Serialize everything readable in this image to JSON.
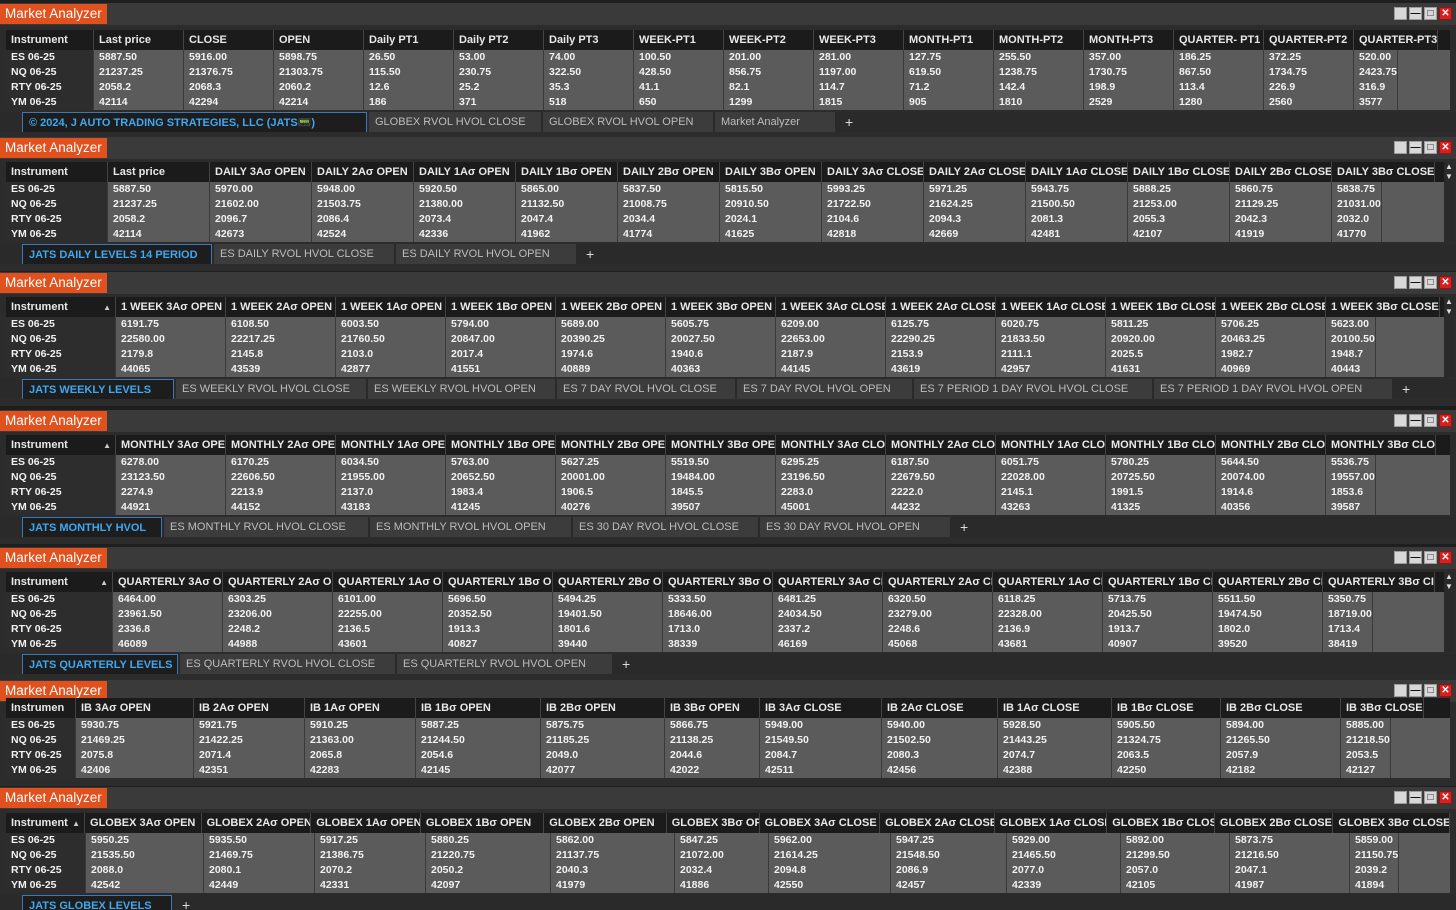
{
  "colors": {
    "title_bg": "#e0511d",
    "active_tab": "#3fa8f0",
    "close_btn": "#d32020"
  },
  "instruments": [
    "ES 06-25",
    "NQ 06-25",
    "RTY 06-25",
    "YM 06-25"
  ],
  "panels": [
    {
      "title": "Market Analyzer",
      "columns": [
        "Instrument",
        "Last price",
        "CLOSE",
        "OPEN",
        "Daily PT1",
        "Daily PT2",
        "Daily PT3",
        "WEEK-PT1",
        "WEEK-PT2",
        "WEEK-PT3",
        "MONTH-PT1",
        "MONTH-PT2",
        "MONTH-PT3",
        "QUARTER- PT1",
        "QUARTER-PT2",
        "QUARTER-PT3"
      ],
      "rows": [
        [
          "5887.50",
          "5916.00",
          "5898.75",
          "26.50",
          "53.00",
          "74.00",
          "100.50",
          "201.00",
          "281.00",
          "127.75",
          "255.50",
          "357.00",
          "186.25",
          "372.25",
          "520.00"
        ],
        [
          "21237.25",
          "21376.75",
          "21303.75",
          "115.50",
          "230.75",
          "322.50",
          "428.50",
          "856.75",
          "1197.00",
          "619.50",
          "1238.75",
          "1730.75",
          "867.50",
          "1734.75",
          "2423.75"
        ],
        [
          "2058.2",
          "2068.3",
          "2060.2",
          "12.6",
          "25.2",
          "35.3",
          "41.1",
          "82.1",
          "114.7",
          "71.2",
          "142.4",
          "198.9",
          "113.4",
          "226.9",
          "316.9"
        ],
        [
          "42114",
          "42294",
          "42214",
          "186",
          "371",
          "518",
          "650",
          "1299",
          "1815",
          "905",
          "1810",
          "2529",
          "1280",
          "2560",
          "3577"
        ]
      ],
      "tabs": [
        "© 2024, J AUTO TRADING STRATEGIES, LLC (JATS📟)",
        "GLOBEX RVOL HVOL CLOSE",
        "GLOBEX RVOL HVOL OPEN",
        "Market Analyzer",
        "+"
      ]
    },
    {
      "title": "Market Analyzer",
      "columns": [
        "Instrument",
        "Last price",
        "DAILY 3Aσ OPEN",
        "DAILY 2Aσ OPEN",
        "DAILY 1Aσ OPEN",
        "DAILY 1Bσ OPEN",
        "DAILY 2Bσ OPEN",
        "DAILY 3Bσ OPEN",
        "DAILY 3Aσ CLOSE",
        "DAILY 2Aσ CLOSE",
        "DAILY 1Aσ CLOSE",
        "DAILY 1Bσ CLOSE",
        "DAILY 2Bσ CLOSE",
        "DAILY 3Bσ CLOSE"
      ],
      "rows": [
        [
          "5887.50",
          "5970.00",
          "5948.00",
          "5920.50",
          "5865.00",
          "5837.50",
          "5815.50",
          "5993.25",
          "5971.25",
          "5943.75",
          "5888.25",
          "5860.75",
          "5838.75"
        ],
        [
          "21237.25",
          "21602.00",
          "21503.75",
          "21380.00",
          "21132.50",
          "21008.75",
          "20910.50",
          "21722.50",
          "21624.25",
          "21500.50",
          "21253.00",
          "21129.25",
          "21031.00"
        ],
        [
          "2058.2",
          "2096.7",
          "2086.4",
          "2073.4",
          "2047.4",
          "2034.4",
          "2024.1",
          "2104.6",
          "2094.3",
          "2081.3",
          "2055.3",
          "2042.3",
          "2032.0"
        ],
        [
          "42114",
          "42673",
          "42524",
          "42336",
          "41962",
          "41774",
          "41625",
          "42818",
          "42669",
          "42481",
          "42107",
          "41919",
          "41770"
        ]
      ],
      "tabs": [
        "JATS DAILY LEVELS 14 PERIOD",
        "ES DAILY RVOL HVOL CLOSE",
        "ES DAILY RVOL HVOL OPEN",
        "+"
      ]
    },
    {
      "title": "Market Analyzer",
      "columns": [
        "Instrument",
        "1 WEEK 3Aσ OPEN",
        "1 WEEK 2Aσ OPEN",
        "1 WEEK 1Aσ OPEN",
        "1 WEEK 1Bσ OPEN",
        "1 WEEK 2Bσ OPEN",
        "1 WEEK 3Bσ OPEN",
        "1 WEEK 3Aσ CLOSE",
        "1 WEEK 2Aσ CLOSE",
        "1 WEEK 1Aσ CLOSE",
        "1 WEEK 1Bσ CLOSE",
        "1 WEEK 2Bσ CLOSE",
        "1 WEEK 3Bσ CLOSE"
      ],
      "rows": [
        [
          "6191.75",
          "6108.50",
          "6003.50",
          "5794.00",
          "5689.00",
          "5605.75",
          "6209.00",
          "6125.75",
          "6020.75",
          "5811.25",
          "5706.25",
          "5623.00"
        ],
        [
          "22580.00",
          "22217.25",
          "21760.50",
          "20847.00",
          "20390.25",
          "20027.50",
          "22653.00",
          "22290.25",
          "21833.50",
          "20920.00",
          "20463.25",
          "20100.50"
        ],
        [
          "2179.8",
          "2145.8",
          "2103.0",
          "2017.4",
          "1974.6",
          "1940.6",
          "2187.9",
          "2153.9",
          "2111.1",
          "2025.5",
          "1982.7",
          "1948.7"
        ],
        [
          "44065",
          "43539",
          "42877",
          "41551",
          "40889",
          "40363",
          "44145",
          "43619",
          "42957",
          "41631",
          "40969",
          "40443"
        ]
      ],
      "tabs": [
        "JATS WEEKLY LEVELS",
        "ES WEEKLY RVOL HVOL CLOSE",
        "ES WEEKLY RVOL HVOL OPEN",
        "ES 7 DAY RVOL HVOL CLOSE",
        "ES 7 DAY RVOL HVOL OPEN",
        "ES 7 PERIOD 1 DAY RVOL HVOL CLOSE",
        "ES 7 PERIOD 1 DAY RVOL HVOL OPEN",
        "+"
      ]
    },
    {
      "title": "Market Analyzer",
      "columns": [
        "Instrument",
        "MONTHLY 3Aσ OPEI",
        "MONTHLY 2Aσ OPEI",
        "MONTHLY 1Aσ OPEI",
        "MONTHLY 1Bσ OPE",
        "MONTHLY 2Bσ OPE",
        "MONTHLY 3Bσ OPE",
        "MONTHLY 3Aσ CLO",
        "MONTHLY 2Aσ CLO",
        "MONTHLY 1Aσ CLO",
        "MONTHLY 1Bσ CLO",
        "MONTHLY 2Bσ CLO",
        "MONTHLY 3Bσ CLO"
      ],
      "rows": [
        [
          "6278.00",
          "6170.25",
          "6034.50",
          "5763.00",
          "5627.25",
          "5519.50",
          "6295.25",
          "6187.50",
          "6051.75",
          "5780.25",
          "5644.50",
          "5536.75"
        ],
        [
          "23123.50",
          "22606.50",
          "21955.00",
          "20652.50",
          "20001.00",
          "19484.00",
          "23196.50",
          "22679.50",
          "22028.00",
          "20725.50",
          "20074.00",
          "19557.00"
        ],
        [
          "2274.9",
          "2213.9",
          "2137.0",
          "1983.4",
          "1906.5",
          "1845.5",
          "2283.0",
          "2222.0",
          "2145.1",
          "1991.5",
          "1914.6",
          "1853.6"
        ],
        [
          "44921",
          "44152",
          "43183",
          "41245",
          "40276",
          "39507",
          "45001",
          "44232",
          "43263",
          "41325",
          "40356",
          "39587"
        ]
      ],
      "tabs": [
        "JATS MONTHLY HVOL",
        "ES MONTHLY RVOL HVOL CLOSE",
        "ES MONTHLY RVOL HVOL OPEN",
        "ES 30 DAY RVOL HVOL CLOSE",
        "ES 30 DAY RVOL HVOL OPEN",
        "+"
      ]
    },
    {
      "title": "Market Analyzer",
      "columns": [
        "Instrument",
        "QUARTERLY 3Aσ OF",
        "QUARTERLY 2Aσ OF",
        "QUARTERLY 1Aσ OF",
        "QUARTERLY 1Bσ OI",
        "QUARTERLY 2Bσ OI",
        "QUARTERLY 3Bσ OI",
        "QUARTERLY 3Aσ CL",
        "QUARTERLY 2Aσ CL",
        "QUARTERLY 1Aσ CL",
        "QUARTERLY 1Bσ CI",
        "QUARTERLY 2Bσ CI",
        "QUARTERLY 3Bσ CI"
      ],
      "rows": [
        [
          "6464.00",
          "6303.25",
          "6101.00",
          "5696.50",
          "5494.25",
          "5333.50",
          "6481.25",
          "6320.50",
          "6118.25",
          "5713.75",
          "5511.50",
          "5350.75"
        ],
        [
          "23961.50",
          "23206.00",
          "22255.00",
          "20352.50",
          "19401.50",
          "18646.00",
          "24034.50",
          "23279.00",
          "22328.00",
          "20425.50",
          "19474.50",
          "18719.00"
        ],
        [
          "2336.8",
          "2248.2",
          "2136.5",
          "1913.3",
          "1801.6",
          "1713.0",
          "2337.2",
          "2248.6",
          "2136.9",
          "1913.7",
          "1802.0",
          "1713.4"
        ],
        [
          "46089",
          "44988",
          "43601",
          "40827",
          "39440",
          "38339",
          "46169",
          "45068",
          "43681",
          "40907",
          "39520",
          "38419"
        ]
      ],
      "tabs": [
        "JATS QUARTERLY LEVELS",
        "ES QUARTERLY RVOL HVOL CLOSE",
        "ES QUARTERLY RVOL HVOL OPEN",
        "+"
      ]
    },
    {
      "title": "Market Analyzer",
      "columns": [
        "Instrumen",
        "IB 3Aσ OPEN",
        "IB 2Aσ OPEN",
        "IB 1Aσ OPEN",
        "IB 1Bσ OPEN",
        "IB 2Bσ OPEN",
        "IB 3Bσ OPEN",
        "IB 3Aσ CLOSE",
        "IB 2Aσ CLOSE",
        "IB 1Aσ CLOSE",
        "IB 1Bσ CLOSE",
        "IB 2Bσ CLOSE",
        "IB 3Bσ CLOSE"
      ],
      "rows": [
        [
          "5930.75",
          "5921.75",
          "5910.25",
          "5887.25",
          "5875.75",
          "5866.75",
          "5949.00",
          "5940.00",
          "5928.50",
          "5905.50",
          "5894.00",
          "5885.00"
        ],
        [
          "21469.25",
          "21422.25",
          "21363.00",
          "21244.50",
          "21185.25",
          "21138.25",
          "21549.50",
          "21502.50",
          "21443.25",
          "21324.75",
          "21265.50",
          "21218.50"
        ],
        [
          "2075.8",
          "2071.4",
          "2065.8",
          "2054.6",
          "2049.0",
          "2044.6",
          "2084.7",
          "2080.3",
          "2074.7",
          "2063.5",
          "2057.9",
          "2053.5"
        ],
        [
          "42406",
          "42351",
          "42283",
          "42145",
          "42077",
          "42022",
          "42511",
          "42456",
          "42388",
          "42250",
          "42182",
          "42127"
        ]
      ],
      "tabs": []
    },
    {
      "title": "Market Analyzer",
      "columns": [
        "Instrument",
        "GLOBEX 3Aσ OPEN",
        "GLOBEX 2Aσ OPEN",
        "GLOBEX 1Aσ OPEN",
        "GLOBEX 1Bσ OPEN",
        "GLOBEX 2Bσ OPEN",
        "GLOBEX 3Bσ OF",
        "GLOBEX 3Aσ CLOSE",
        "GLOBEX 2Aσ CLOSE",
        "GLOBEX 1Aσ CLOSE",
        "GLOBEX 1Bσ CLOS",
        "GLOBEX 2Bσ CLOSE",
        "GLOBEX 3Bσ CLOSE"
      ],
      "rows": [
        [
          "5950.25",
          "5935.50",
          "5917.25",
          "5880.25",
          "5862.00",
          "5847.25",
          "5962.00",
          "5947.25",
          "5929.00",
          "5892.00",
          "5873.75",
          "5859.00"
        ],
        [
          "21535.50",
          "21469.75",
          "21386.75",
          "21220.75",
          "21137.75",
          "21072.00",
          "21614.25",
          "21548.50",
          "21465.50",
          "21299.50",
          "21216.50",
          "21150.75"
        ],
        [
          "2088.0",
          "2080.1",
          "2070.2",
          "2050.2",
          "2040.3",
          "2032.4",
          "2094.8",
          "2086.9",
          "2077.0",
          "2057.0",
          "2047.1",
          "2039.2"
        ],
        [
          "42542",
          "42449",
          "42331",
          "42097",
          "41979",
          "41886",
          "42550",
          "42457",
          "42339",
          "42105",
          "41987",
          "41894"
        ]
      ],
      "tabs": [
        "JATS GLOBEX LEVELS",
        "+"
      ]
    }
  ]
}
